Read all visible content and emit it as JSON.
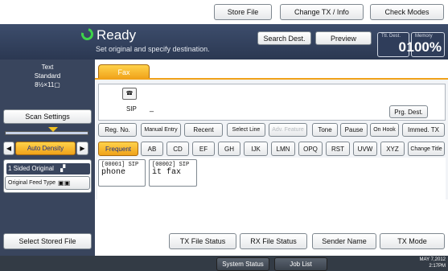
{
  "topbar": {
    "store_file": "Store File",
    "change_tx": "Change TX / Info",
    "check_modes": "Check Modes"
  },
  "header": {
    "status": "Ready",
    "message": "Set original and specify destination.",
    "search_dest": "Search Dest.",
    "preview": "Preview",
    "ttl_dest_label": "Ttl. Dest.",
    "ttl_dest_value": "0",
    "memory_label": "Memory",
    "memory_value": "100%"
  },
  "scan": {
    "line1": "Text",
    "line2": "Standard",
    "line3": "8½×11▢",
    "settings_button": "Scan Settings",
    "auto_density": "Auto Density",
    "sided_original": "1 Sided Original",
    "feed_type": "Original Feed Type",
    "select_stored_file": "Select Stored File"
  },
  "tabs": {
    "fax": "Fax"
  },
  "display": {
    "line_label": "SIP",
    "cursor": "_",
    "prg_dest": "Prg. Dest."
  },
  "entry_buttons": [
    "Reg. No.",
    "Manual Entry",
    "Recent",
    "Select Line",
    "Adv. Feature",
    "Tone",
    "Pause",
    "On Hook",
    "Immed. TX"
  ],
  "index_tabs": [
    "Frequent",
    "AB",
    "CD",
    "EF",
    "GH",
    "IJK",
    "LMN",
    "OPQ",
    "RST",
    "UVW",
    "XYZ",
    "Change Title"
  ],
  "destinations": [
    {
      "code": "[00001] SIP",
      "name": "phone"
    },
    {
      "code": "[00002] SIP",
      "name": "it fax"
    }
  ],
  "bottom_buttons": {
    "tx_status": "TX File Status",
    "rx_status": "RX File Status",
    "sender_name": "Sender Name",
    "tx_mode": "TX Mode"
  },
  "footer": {
    "system_status": "System Status",
    "job_list": "Job List",
    "date": "MAY 7,2012",
    "time": "2:17PM"
  },
  "colors": {
    "accent": "#f0a21a",
    "header": "#2f3d5a",
    "ready_ring": "#3fd44a"
  }
}
